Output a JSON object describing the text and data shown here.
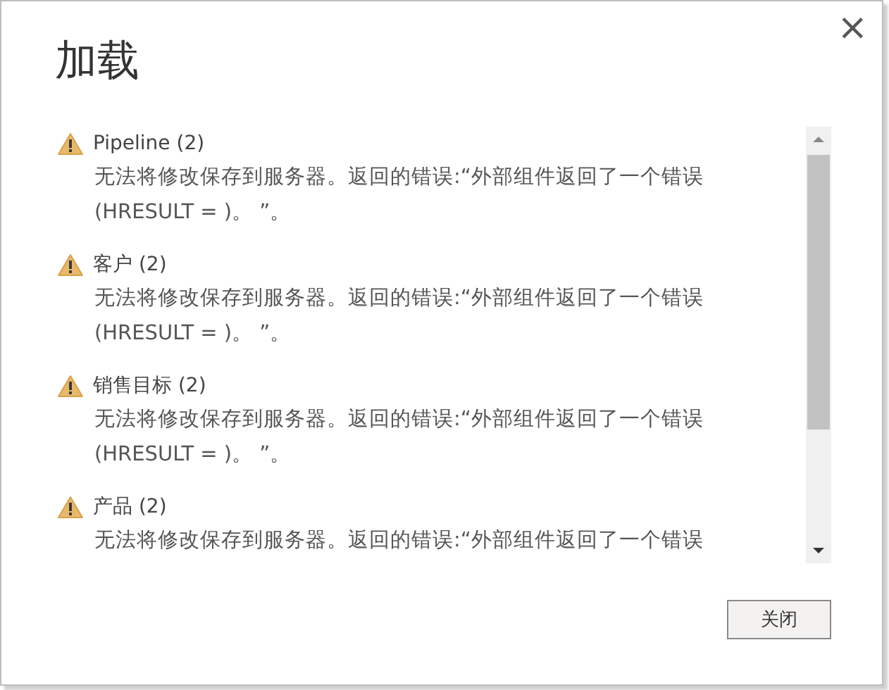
{
  "window": {
    "title": "加载",
    "close": "×"
  },
  "items": [
    {
      "name": "Pipeline",
      "count": "(2)",
      "message_lines": [
        "无法将修改保存到服务器。返回的错误:“外部组件返回了一个错误",
        "(HRESULT = )。 ”。"
      ]
    },
    {
      "name": "客户",
      "count": "(2)",
      "message_lines": [
        "无法将修改保存到服务器。返回的错误:“外部组件返回了一个错误",
        "(HRESULT = )。 ”。"
      ]
    },
    {
      "name": "销售目标",
      "count": "(2)",
      "message_lines": [
        "无法将修改保存到服务器。返回的错误:“外部组件返回了一个错误",
        "(HRESULT = )。 ”。"
      ]
    },
    {
      "name": "产品",
      "count": "(2)",
      "message_lines": [
        "无法将修改保存到服务器。返回的错误:“外部组件返回了一个错误"
      ]
    }
  ],
  "buttons": [
    "关闭"
  ]
}
